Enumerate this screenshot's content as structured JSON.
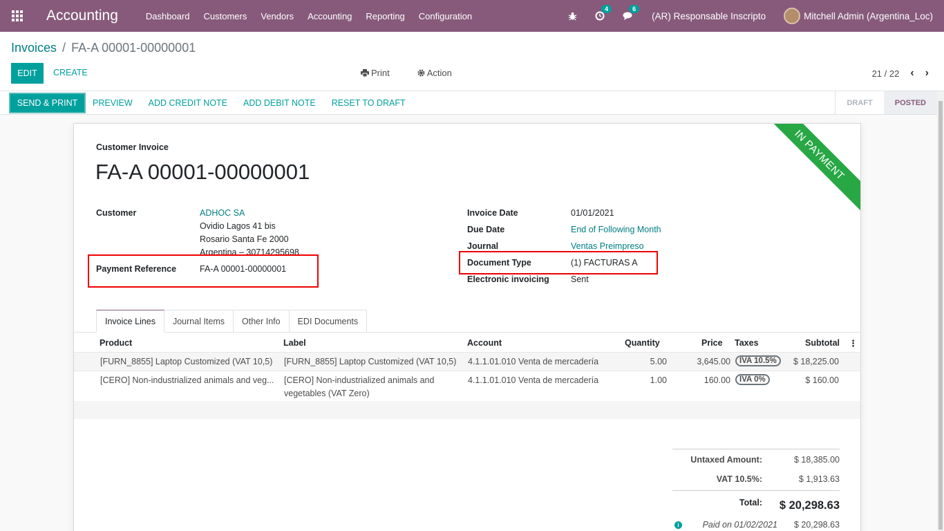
{
  "navbar": {
    "app_name": "Accounting",
    "menu": [
      "Dashboard",
      "Customers",
      "Vendors",
      "Accounting",
      "Reporting",
      "Configuration"
    ],
    "activity_count": "4",
    "messages_count": "6",
    "company": "(AR) Responsable Inscripto",
    "user": "Mitchell Admin (Argentina_Loc)"
  },
  "breadcrumb": {
    "parent": "Invoices",
    "separator": "/",
    "current": "FA-A 00001-00000001"
  },
  "control": {
    "edit": "EDIT",
    "create": "CREATE",
    "print": "Print",
    "action": "Action",
    "pager": "21 / 22"
  },
  "statusbar": {
    "send_print": "SEND & PRINT",
    "buttons": [
      "PREVIEW",
      "ADD CREDIT NOTE",
      "ADD DEBIT NOTE",
      "RESET TO DRAFT"
    ],
    "states": [
      "DRAFT",
      "POSTED"
    ]
  },
  "invoice": {
    "ribbon": "IN PAYMENT",
    "type_label": "Customer Invoice",
    "name": "FA-A 00001-00000001",
    "customer_label": "Customer",
    "customer_name": "ADHOC SA",
    "customer_address": [
      "Ovidio Lagos 41 bis",
      "Rosario Santa Fe 2000",
      "Argentina – 30714295698"
    ],
    "payment_ref_label": "Payment Reference",
    "payment_ref": "FA-A 00001-00000001",
    "invoice_date_label": "Invoice Date",
    "invoice_date": "01/01/2021",
    "due_date_label": "Due Date",
    "due_date": "End of Following Month",
    "journal_label": "Journal",
    "journal": "Ventas Preimpreso",
    "doc_type_label": "Document Type",
    "doc_type": "(1) FACTURAS A",
    "einvoicing_label": "Electronic invoicing",
    "einvoicing": "Sent"
  },
  "tabs": [
    "Invoice Lines",
    "Journal Items",
    "Other Info",
    "EDI Documents"
  ],
  "lines": {
    "headers": {
      "product": "Product",
      "label": "Label",
      "account": "Account",
      "quantity": "Quantity",
      "price": "Price",
      "taxes": "Taxes",
      "subtotal": "Subtotal"
    },
    "rows": [
      {
        "product": "[FURN_8855] Laptop Customized (VAT 10,5)",
        "label_1": "[FURN_8855] Laptop Customized (VAT 10,5)",
        "label_2": "",
        "account": "4.1.1.01.010 Venta de mercadería",
        "quantity": "5.00",
        "price": "3,645.00",
        "tax": "IVA 10.5%",
        "subtotal": "$ 18,225.00"
      },
      {
        "product": "[CERO] Non-industrialized animals and veg...",
        "label_1": "[CERO] Non-industrialized animals and",
        "label_2": "vegetables (VAT Zero)",
        "account": "4.1.1.01.010 Venta de mercadería",
        "quantity": "1.00",
        "price": "160.00",
        "tax": "IVA 0%",
        "subtotal": "$ 160.00"
      }
    ]
  },
  "totals": {
    "untaxed_label": "Untaxed Amount:",
    "untaxed": "$ 18,385.00",
    "vat_label": "VAT 10.5%:",
    "vat": "$ 1,913.63",
    "total_label": "Total:",
    "total": "$ 20,298.63",
    "paid_label": "Paid on 01/02/2021",
    "paid": "$ 20,298.63"
  }
}
